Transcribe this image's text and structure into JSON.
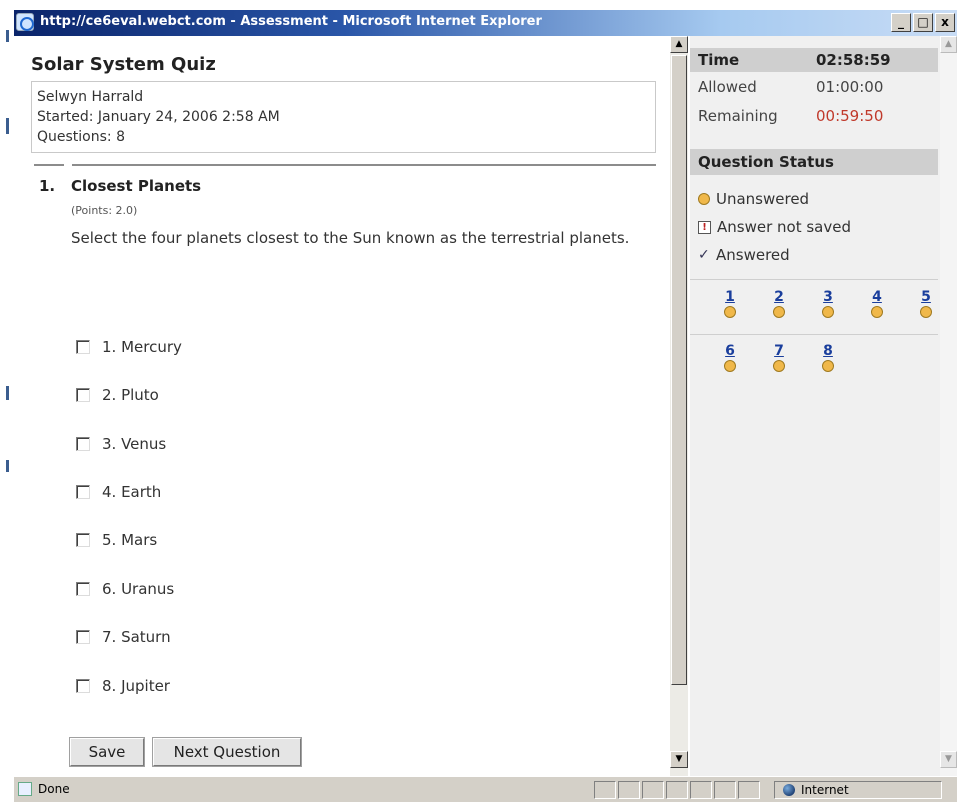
{
  "window": {
    "title": "http://ce6eval.webct.com - Assessment - Microsoft Internet Explorer",
    "controls": [
      "_",
      "□",
      "x"
    ]
  },
  "quiz": {
    "title": "Solar System Quiz",
    "student": "Selwyn Harrald",
    "started": "Started: January 24, 2006 2:58 AM",
    "questions_count": "Questions: 8"
  },
  "question": {
    "number": "1.",
    "title": "Closest Planets",
    "points": "(Points: 2.0)",
    "prompt": "Select the four planets closest to the Sun known as the terrestrial planets.",
    "options": [
      "1. Mercury",
      "2. Pluto",
      "3. Venus",
      "4. Earth",
      "5. Mars",
      "6. Uranus",
      "7. Saturn",
      "8. Jupiter"
    ]
  },
  "buttons": {
    "save": "Save",
    "next": "Next Question"
  },
  "timer": {
    "label": "Time",
    "current": "02:58:59",
    "allowed_label": "Allowed",
    "allowed": "01:00:00",
    "remaining_label": "Remaining",
    "remaining": "00:59:50",
    "remaining_color": "#c0392b"
  },
  "status": {
    "header": "Question Status",
    "legend": {
      "unanswered": "Unanswered",
      "not_saved": "Answer not saved",
      "answered": "Answered"
    },
    "nav": [
      "1",
      "2",
      "3",
      "4",
      "5",
      "6",
      "7",
      "8"
    ],
    "unanswered_color": "#f0b84a"
  },
  "statusbar": {
    "text": "Done",
    "zone": "Internet"
  }
}
